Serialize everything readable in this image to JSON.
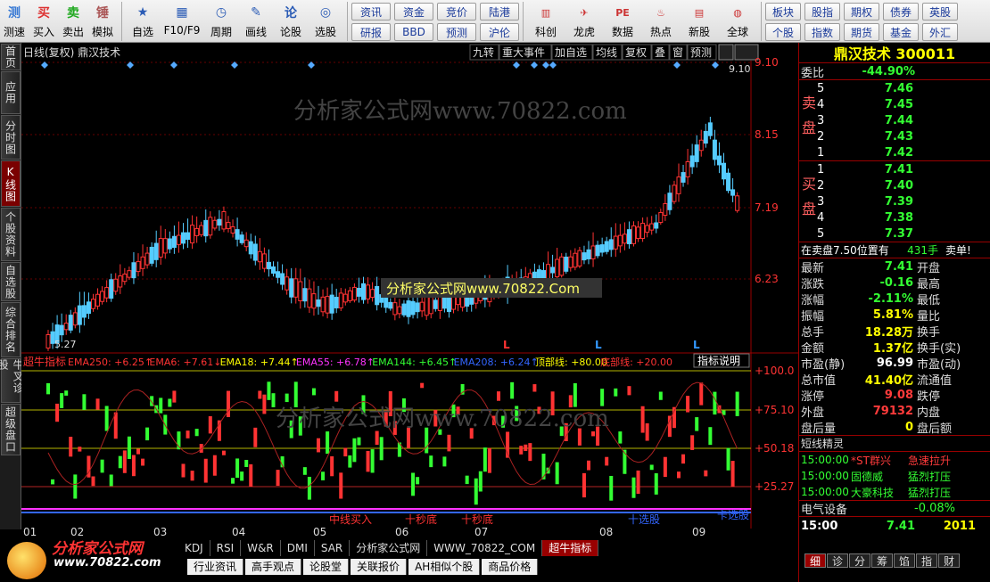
{
  "toolbar": {
    "group1": [
      {
        "label": "测速",
        "icon": "测"
      },
      {
        "label": "买入",
        "icon": "买"
      },
      {
        "label": "卖出",
        "icon": "卖"
      },
      {
        "label": "模拟",
        "icon": "锤"
      }
    ],
    "group2": [
      {
        "label": "自选"
      },
      {
        "label": "F10/F9"
      },
      {
        "label": "周期"
      },
      {
        "label": "画线"
      },
      {
        "label": "论股"
      },
      {
        "label": "选股"
      }
    ],
    "grid1": [
      "资讯",
      "资金",
      "竞价",
      "陆港",
      "研报",
      "BBD",
      "预测",
      "沪伦"
    ],
    "group3": [
      {
        "label": "科创"
      },
      {
        "label": "龙虎"
      },
      {
        "label": "数据"
      },
      {
        "label": "热点"
      },
      {
        "label": "新股"
      },
      {
        "label": "全球"
      }
    ],
    "grid2": [
      "板块",
      "股指",
      "期权",
      "债券",
      "英股",
      "个股",
      "指数",
      "期货",
      "基金",
      "外汇"
    ]
  },
  "leftnav": [
    {
      "label": "首页"
    },
    {
      "label": "应用"
    },
    {
      "label": "分时图"
    },
    {
      "label": "K线图",
      "active": true
    },
    {
      "label": "个股资料"
    },
    {
      "label": "自选股"
    },
    {
      "label": "综合排名"
    },
    {
      "label": "牛叉诊股"
    },
    {
      "label": "超级盘口"
    }
  ],
  "chart": {
    "title": "日线(复权) 鼎汉技术",
    "top_buttons": [
      "九转",
      "重大事件",
      "加自选",
      "均线",
      "复权",
      "叠",
      "窗",
      "预测"
    ],
    "price_labels": [
      "9.10",
      "8.15",
      "7.19",
      "6.23"
    ],
    "high_label": "9.10",
    "low_label": "5.27",
    "watermark": "分析家公式网www.70822.com",
    "watermark_box": "分析家公式网www.70822.Com",
    "indicator_name": "超牛指标",
    "indicator_legend": [
      {
        "text": "EMA250: +6.25↑",
        "color": "#ff3333"
      },
      {
        "text": "EMA6: +7.61↓",
        "color": "#ff3333"
      },
      {
        "text": "EMA18: +7.44↑",
        "color": "#ffff00"
      },
      {
        "text": "EMA55: +6.78↑",
        "color": "#ff33ff"
      },
      {
        "text": "EMA144: +6.45↑",
        "color": "#33ff33"
      },
      {
        "text": "EMA208: +6.24↑",
        "color": "#3366ff"
      },
      {
        "text": "顶部线: +80.00",
        "color": "#ffff00"
      },
      {
        "text": "底部线: +20.00",
        "color": "#ff3333"
      }
    ],
    "indicator_button": "指标说明",
    "indicator_scale": [
      "+100.0",
      "+75.10",
      "+50.18",
      "+25.27"
    ],
    "indicator_texts": [
      "中线买入",
      "十秒底",
      "十秒底",
      "十选股",
      "卡选股"
    ],
    "x_labels": [
      "01",
      "02",
      "03",
      "04",
      "05",
      "06",
      "07",
      "08",
      "09"
    ],
    "l_markers": [
      "L",
      "L",
      "L"
    ]
  },
  "bottomtabs": [
    "KDJ",
    "RSI",
    "W&R",
    "DMI",
    "SAR",
    "分析家公式网",
    "WWW_70822_COM",
    "超牛指标"
  ],
  "bottomtabs2": [
    "行业资讯",
    "高手观点",
    "论股堂",
    "关联报价",
    "AH相似个股",
    "商品价格"
  ],
  "logo": {
    "name": "分析家公式网",
    "url": "www.70822.com"
  },
  "quote": {
    "title": "鼎汉技术 300011",
    "weibi_label": "委比",
    "weibi_value": "-44.90%",
    "sell_label": "卖盘",
    "buy_label": "买盘",
    "sells": [
      {
        "n": "5",
        "p": "7.46"
      },
      {
        "n": "4",
        "p": "7.45"
      },
      {
        "n": "3",
        "p": "7.44"
      },
      {
        "n": "2",
        "p": "7.43"
      },
      {
        "n": "1",
        "p": "7.42"
      }
    ],
    "buys": [
      {
        "n": "1",
        "p": "7.41"
      },
      {
        "n": "2",
        "p": "7.40"
      },
      {
        "n": "3",
        "p": "7.39"
      },
      {
        "n": "4",
        "p": "7.38"
      },
      {
        "n": "5",
        "p": "7.37"
      }
    ],
    "note_left": "在卖盘7.50位置有",
    "note_mid": "431手",
    "note_right": "卖单!",
    "stats": [
      {
        "l": "最新",
        "v": "7.41",
        "r": "开盘",
        "c": "green"
      },
      {
        "l": "涨跌",
        "v": "-0.16",
        "r": "最高",
        "c": "green"
      },
      {
        "l": "涨幅",
        "v": "-2.11%",
        "r": "最低",
        "c": "green"
      },
      {
        "l": "振幅",
        "v": "5.81%",
        "r": "量比",
        "c": "yellow"
      },
      {
        "l": "总手",
        "v": "18.28万",
        "r": "换手",
        "c": "yellow"
      },
      {
        "l": "金额",
        "v": "1.37亿",
        "r": "换手(实)",
        "c": "yellow"
      },
      {
        "l": "市盈(静)",
        "v": "96.99",
        "r": "市盈(动)",
        "c": "white"
      },
      {
        "l": "总市值",
        "v": "41.40亿",
        "r": "流通值",
        "c": "yellow"
      },
      {
        "l": "涨停",
        "v": "9.08",
        "r": "跌停",
        "c": "red"
      },
      {
        "l": "外盘",
        "v": "79132",
        "r": "内盘",
        "c": "red"
      },
      {
        "l": "盘后量",
        "v": "0",
        "r": "盘后额",
        "c": "yellow"
      }
    ],
    "short_title": "短线精灵",
    "short_rows": [
      {
        "t": "15:00:00",
        "name": "*ST群兴",
        "act": "急速拉升",
        "c": "red"
      },
      {
        "t": "15:00:00",
        "name": "固德威",
        "act": "猛烈打压",
        "c": "green"
      },
      {
        "t": "15:00:00",
        "name": "大豪科技",
        "act": "猛烈打压",
        "c": "green"
      }
    ],
    "sector_name": "电气设备",
    "sector_chg": "-0.08%",
    "time": "15:00",
    "last": "7.41",
    "vol": "2011",
    "tabs": [
      "细",
      "诊",
      "分",
      "筹",
      "馅",
      "指",
      "财"
    ]
  },
  "colors": {
    "up": "#ff3333",
    "down": "#00ffff",
    "accent": "#990000"
  }
}
